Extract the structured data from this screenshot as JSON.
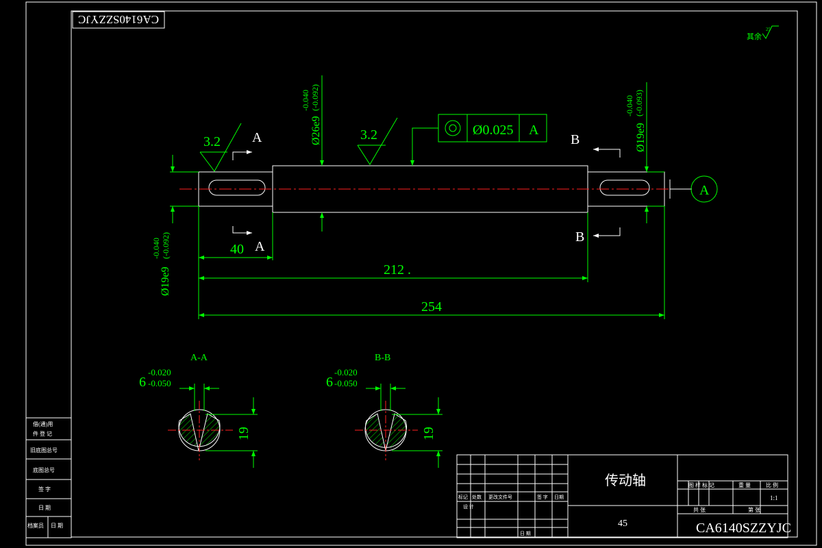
{
  "drawing": {
    "code_box": "CA6140SZZYJC",
    "roughness_other": "其余",
    "roughness_other_value": "25",
    "roughness_1": "3.2",
    "roughness_2": "3.2",
    "section_a_label": "A",
    "section_b_label": "B",
    "datum_label": "A",
    "fcf_value": "Ø0.025",
    "fcf_datum": "A",
    "dia_left_nominal": "Ø19e9",
    "dia_left_tol_upper": "-0.040",
    "dia_left_tol_lower": "(-0.092)",
    "dia_mid_nominal": "Ø26e9",
    "dia_mid_tol_upper": "-0.040",
    "dia_mid_tol_lower": "(-0.092)",
    "dia_right_nominal": "Ø19e9",
    "dia_right_tol_upper": "-0.040",
    "dia_right_tol_lower": "(-0.093)",
    "dim_40": "40",
    "dim_212": "212 .",
    "dim_254": "254",
    "sec_aa_title": "A-A",
    "sec_bb_title": "B-B",
    "key_width": "6",
    "key_tol_upper": "-0.020",
    "key_tol_lower": "-0.050",
    "key_depth": "19"
  },
  "title_block": {
    "part_name": "传动轴",
    "material": "45",
    "drawing_no": "CA6140SZZYJC",
    "scale": "1:1",
    "h_stage": "图 样 标 记",
    "h_weight": "重 量",
    "h_scale": "比 例",
    "h_sheets": "共 张",
    "h_sheet": "第 张",
    "rev_mark": "标记",
    "rev_count": "处数",
    "rev_doc": "更改文件号",
    "rev_sign": "签 字",
    "rev_date": "日期",
    "designer": "设 计",
    "date2": "日 期"
  },
  "side_block": {
    "r1a": "借(通)用",
    "r1b": "件 登 记",
    "r2": "旧底图总号",
    "r3": "底图总号",
    "r4": "签 字",
    "r5": "日 期",
    "r6a": "档案员",
    "r6b": "日 期"
  }
}
